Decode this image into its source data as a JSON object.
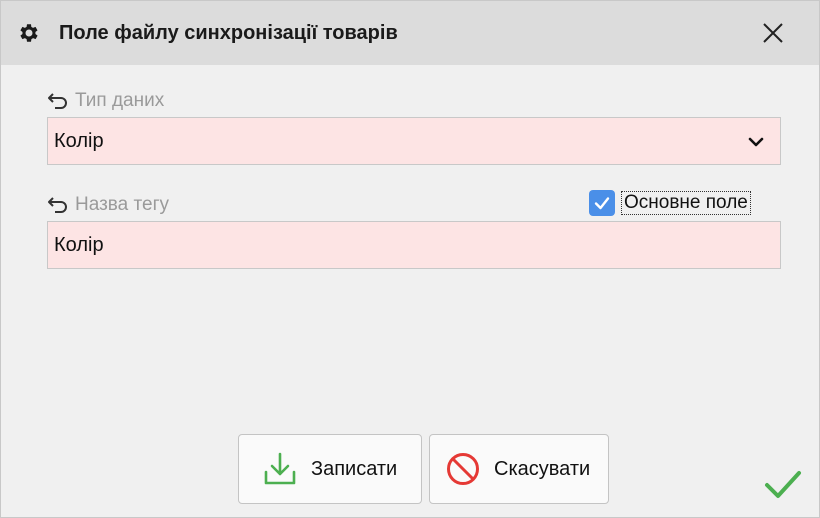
{
  "window": {
    "title": "Поле файлу синхронізації товарів"
  },
  "fields": {
    "data_type": {
      "label": "Тип даних",
      "value": "Колір"
    },
    "tag_name": {
      "label": "Назва тегу",
      "value": "Колір"
    }
  },
  "main_field": {
    "label": "Основне поле",
    "checked": true
  },
  "buttons": {
    "save_label": "Записати",
    "cancel_label": "Скасувати"
  },
  "colors": {
    "field_background": "#fde4e4",
    "checkbox_accent": "#4a8fe8",
    "save_icon": "#4caf50",
    "cancel_icon": "#e53935",
    "ok_check": "#4caf50"
  },
  "icons": {
    "title": "gear-icon",
    "close": "close-icon",
    "field_reset": "undo-icon",
    "dropdown": "chevron-down-icon",
    "save": "download-icon",
    "cancel": "no-entry-icon",
    "ok": "checkmark-icon"
  }
}
